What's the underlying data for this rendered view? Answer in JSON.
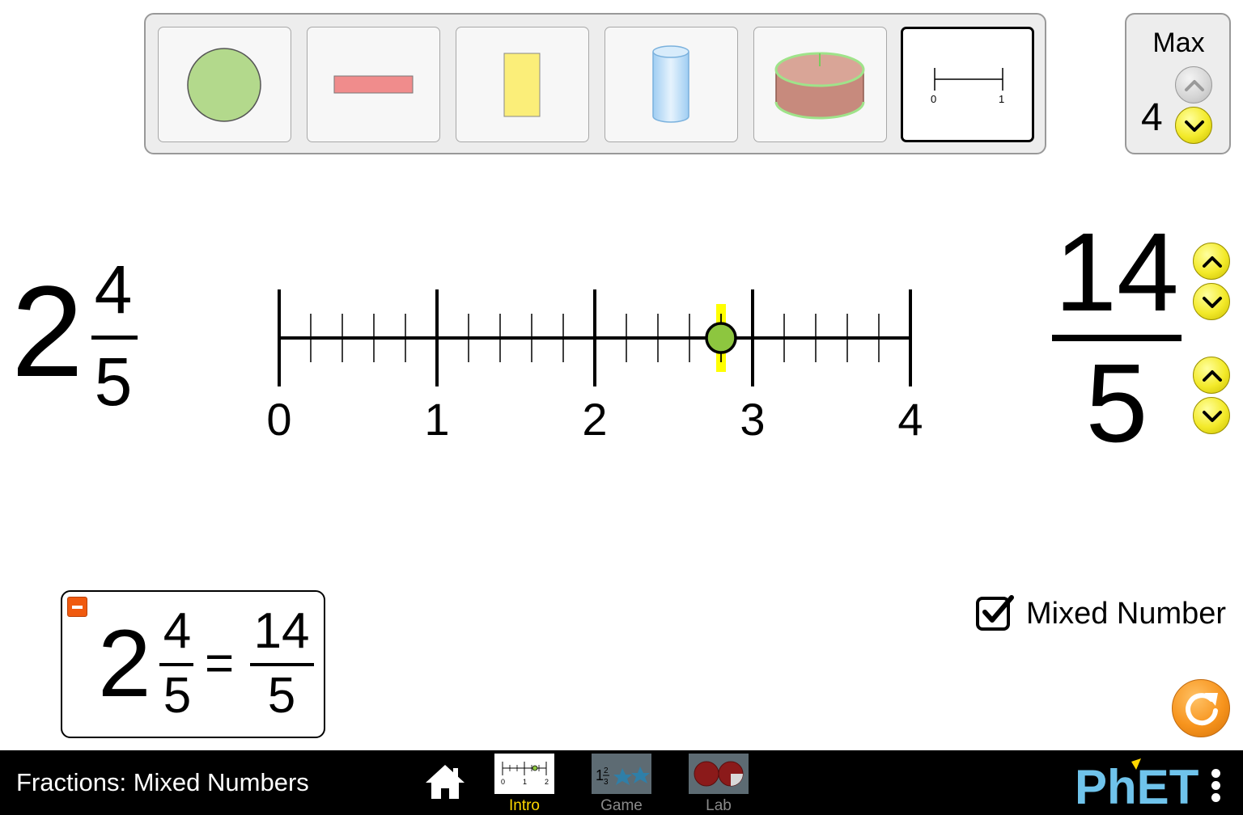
{
  "representations": {
    "items": [
      {
        "name": "circle",
        "selected": false,
        "color": "#b3d98c"
      },
      {
        "name": "horizontal-bar",
        "selected": false,
        "color": "#f08c8c"
      },
      {
        "name": "vertical-bar",
        "selected": false,
        "color": "#fbee79"
      },
      {
        "name": "beaker",
        "selected": false,
        "color": "#bfdffa"
      },
      {
        "name": "cake",
        "selected": false,
        "color": "#c78a7d"
      },
      {
        "name": "number-line",
        "selected": true,
        "tick_labels": [
          "0",
          "1"
        ]
      }
    ]
  },
  "max_control": {
    "label": "Max",
    "value": "4",
    "up_enabled": false,
    "down_enabled": true
  },
  "mixed_number": {
    "whole": "2",
    "numerator": "4",
    "denominator": "5"
  },
  "improper_fraction": {
    "numerator": "14",
    "denominator": "5"
  },
  "number_line": {
    "min": 0,
    "max": 4,
    "subdivisions": 5,
    "labels": [
      "0",
      "1",
      "2",
      "3",
      "4"
    ],
    "marker_value": 2.8,
    "marker_color": "#8dc63f",
    "highlight_color": "#ffff00"
  },
  "equation": {
    "whole": "2",
    "numerator": "4",
    "denominator": "5",
    "equals": "=",
    "improper_numerator": "14",
    "improper_denominator": "5"
  },
  "mixed_number_checkbox": {
    "label": "Mixed Number",
    "checked": true
  },
  "navbar": {
    "title": "Fractions: Mixed Numbers",
    "screens": [
      {
        "label": "Intro",
        "active": true
      },
      {
        "label": "Game",
        "active": false
      },
      {
        "label": "Lab",
        "active": false
      }
    ],
    "logo_text": "PhET",
    "accent_color": "#ffd700"
  }
}
